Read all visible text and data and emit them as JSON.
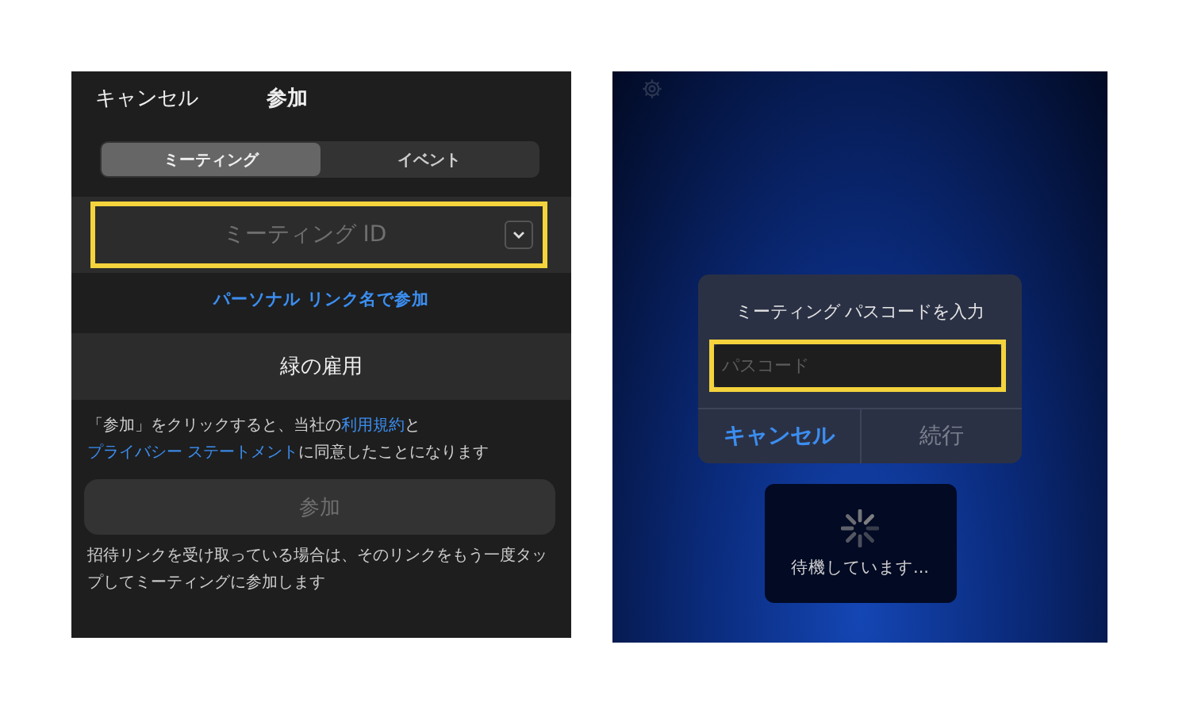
{
  "join_screen": {
    "header": {
      "cancel": "キャンセル",
      "title": "参加"
    },
    "tabs": [
      {
        "label": "ミーティング",
        "selected": true
      },
      {
        "label": "イベント",
        "selected": false
      }
    ],
    "meeting_id": {
      "placeholder": "ミーティング ID",
      "highlighted": true
    },
    "personal_link": "パーソナル リンク名で参加",
    "name": "緑の雇用",
    "agreement": [
      {
        "text": "「参加」をクリックすると、当社の",
        "link": false
      },
      {
        "text": "利用規約",
        "link": true
      },
      {
        "text": "と",
        "link": false
      },
      {
        "text": "プライバシー ステートメント",
        "link": true
      },
      {
        "text": "に同意したことになります",
        "link": false
      }
    ],
    "join_button": {
      "label": "参加",
      "disabled": true
    },
    "note": "招待リンクを受け取っている場合は、そのリンクをもう一度タップしてミーティングに参加します"
  },
  "passcode_screen": {
    "dialog": {
      "title": "ミーティング パスコードを入力",
      "passcode": {
        "placeholder": "パスコード",
        "highlighted": true
      },
      "buttons": [
        {
          "label": "キャンセル",
          "disabled": false
        },
        {
          "label": "続行",
          "disabled": true
        }
      ]
    },
    "waiting": "待機しています..."
  }
}
